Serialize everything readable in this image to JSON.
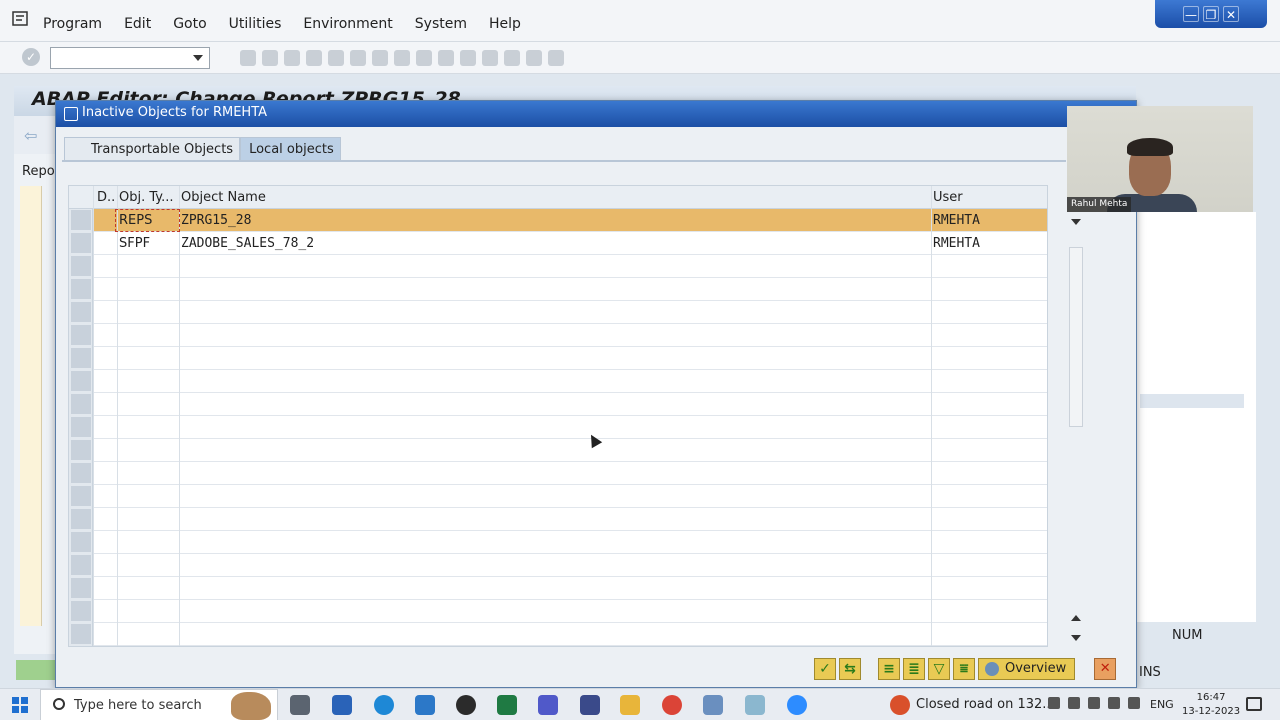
{
  "menubar": {
    "items": [
      "Program",
      "Edit",
      "Goto",
      "Utilities",
      "Environment",
      "System",
      "Help"
    ]
  },
  "window_controls": {
    "minimize": "—",
    "restore": "❐",
    "close": "✕"
  },
  "editor": {
    "title": "ABAP Editor: Change Report ZPRG15_28",
    "report_label": "Repor"
  },
  "dialog": {
    "title": "Inactive Objects for RMEHTA",
    "tabs": [
      "Transportable Objects",
      "Local objects"
    ],
    "active_tab": "Local objects",
    "columns": [
      "D..",
      "Obj. Ty...",
      "Object Name",
      "User"
    ],
    "rows": [
      {
        "type": "REPS",
        "name": "ZPRG15_28",
        "user": "RMEHTA",
        "selected": true
      },
      {
        "type": "SFPF",
        "name": "ZADOBE_SALES_78_2",
        "user": "RMEHTA",
        "selected": false
      }
    ],
    "overview_label": "Overview"
  },
  "status": {
    "num": "NUM",
    "ins": "INS"
  },
  "webcam": {
    "name": "Rahul Mehta"
  },
  "taskbar": {
    "search_placeholder": "Type here to search",
    "weather": "Closed road on 132...",
    "language": "ENG",
    "time": "16:47",
    "date": "13-12-2023"
  },
  "colors": {
    "selected_row": "#e8b96a",
    "title_bar": "#1c4fa5",
    "button_yellow": "#e9ca54"
  }
}
